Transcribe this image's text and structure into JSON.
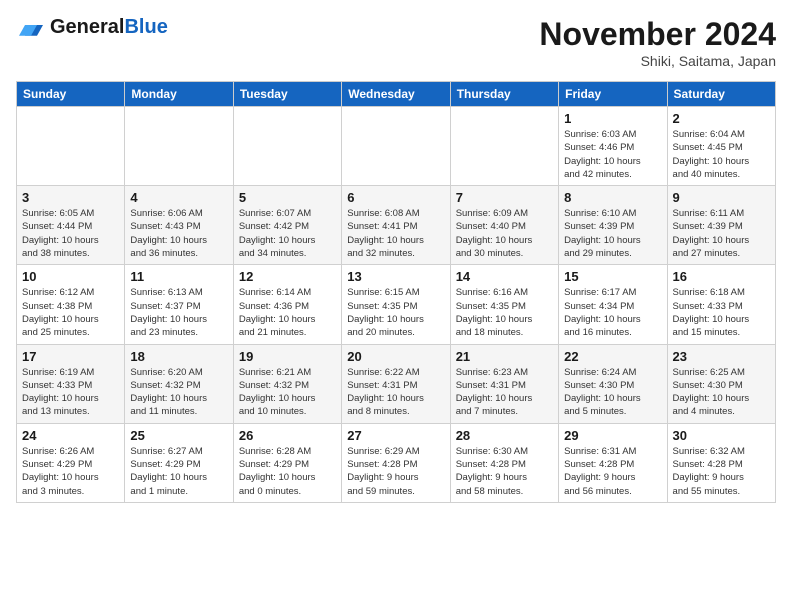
{
  "header": {
    "logo_line1": "General",
    "logo_line2": "Blue",
    "month": "November 2024",
    "location": "Shiki, Saitama, Japan"
  },
  "weekdays": [
    "Sunday",
    "Monday",
    "Tuesday",
    "Wednesday",
    "Thursday",
    "Friday",
    "Saturday"
  ],
  "weeks": [
    [
      {
        "day": "",
        "detail": ""
      },
      {
        "day": "",
        "detail": ""
      },
      {
        "day": "",
        "detail": ""
      },
      {
        "day": "",
        "detail": ""
      },
      {
        "day": "",
        "detail": ""
      },
      {
        "day": "1",
        "detail": "Sunrise: 6:03 AM\nSunset: 4:46 PM\nDaylight: 10 hours\nand 42 minutes."
      },
      {
        "day": "2",
        "detail": "Sunrise: 6:04 AM\nSunset: 4:45 PM\nDaylight: 10 hours\nand 40 minutes."
      }
    ],
    [
      {
        "day": "3",
        "detail": "Sunrise: 6:05 AM\nSunset: 4:44 PM\nDaylight: 10 hours\nand 38 minutes."
      },
      {
        "day": "4",
        "detail": "Sunrise: 6:06 AM\nSunset: 4:43 PM\nDaylight: 10 hours\nand 36 minutes."
      },
      {
        "day": "5",
        "detail": "Sunrise: 6:07 AM\nSunset: 4:42 PM\nDaylight: 10 hours\nand 34 minutes."
      },
      {
        "day": "6",
        "detail": "Sunrise: 6:08 AM\nSunset: 4:41 PM\nDaylight: 10 hours\nand 32 minutes."
      },
      {
        "day": "7",
        "detail": "Sunrise: 6:09 AM\nSunset: 4:40 PM\nDaylight: 10 hours\nand 30 minutes."
      },
      {
        "day": "8",
        "detail": "Sunrise: 6:10 AM\nSunset: 4:39 PM\nDaylight: 10 hours\nand 29 minutes."
      },
      {
        "day": "9",
        "detail": "Sunrise: 6:11 AM\nSunset: 4:39 PM\nDaylight: 10 hours\nand 27 minutes."
      }
    ],
    [
      {
        "day": "10",
        "detail": "Sunrise: 6:12 AM\nSunset: 4:38 PM\nDaylight: 10 hours\nand 25 minutes."
      },
      {
        "day": "11",
        "detail": "Sunrise: 6:13 AM\nSunset: 4:37 PM\nDaylight: 10 hours\nand 23 minutes."
      },
      {
        "day": "12",
        "detail": "Sunrise: 6:14 AM\nSunset: 4:36 PM\nDaylight: 10 hours\nand 21 minutes."
      },
      {
        "day": "13",
        "detail": "Sunrise: 6:15 AM\nSunset: 4:35 PM\nDaylight: 10 hours\nand 20 minutes."
      },
      {
        "day": "14",
        "detail": "Sunrise: 6:16 AM\nSunset: 4:35 PM\nDaylight: 10 hours\nand 18 minutes."
      },
      {
        "day": "15",
        "detail": "Sunrise: 6:17 AM\nSunset: 4:34 PM\nDaylight: 10 hours\nand 16 minutes."
      },
      {
        "day": "16",
        "detail": "Sunrise: 6:18 AM\nSunset: 4:33 PM\nDaylight: 10 hours\nand 15 minutes."
      }
    ],
    [
      {
        "day": "17",
        "detail": "Sunrise: 6:19 AM\nSunset: 4:33 PM\nDaylight: 10 hours\nand 13 minutes."
      },
      {
        "day": "18",
        "detail": "Sunrise: 6:20 AM\nSunset: 4:32 PM\nDaylight: 10 hours\nand 11 minutes."
      },
      {
        "day": "19",
        "detail": "Sunrise: 6:21 AM\nSunset: 4:32 PM\nDaylight: 10 hours\nand 10 minutes."
      },
      {
        "day": "20",
        "detail": "Sunrise: 6:22 AM\nSunset: 4:31 PM\nDaylight: 10 hours\nand 8 minutes."
      },
      {
        "day": "21",
        "detail": "Sunrise: 6:23 AM\nSunset: 4:31 PM\nDaylight: 10 hours\nand 7 minutes."
      },
      {
        "day": "22",
        "detail": "Sunrise: 6:24 AM\nSunset: 4:30 PM\nDaylight: 10 hours\nand 5 minutes."
      },
      {
        "day": "23",
        "detail": "Sunrise: 6:25 AM\nSunset: 4:30 PM\nDaylight: 10 hours\nand 4 minutes."
      }
    ],
    [
      {
        "day": "24",
        "detail": "Sunrise: 6:26 AM\nSunset: 4:29 PM\nDaylight: 10 hours\nand 3 minutes."
      },
      {
        "day": "25",
        "detail": "Sunrise: 6:27 AM\nSunset: 4:29 PM\nDaylight: 10 hours\nand 1 minute."
      },
      {
        "day": "26",
        "detail": "Sunrise: 6:28 AM\nSunset: 4:29 PM\nDaylight: 10 hours\nand 0 minutes."
      },
      {
        "day": "27",
        "detail": "Sunrise: 6:29 AM\nSunset: 4:28 PM\nDaylight: 9 hours\nand 59 minutes."
      },
      {
        "day": "28",
        "detail": "Sunrise: 6:30 AM\nSunset: 4:28 PM\nDaylight: 9 hours\nand 58 minutes."
      },
      {
        "day": "29",
        "detail": "Sunrise: 6:31 AM\nSunset: 4:28 PM\nDaylight: 9 hours\nand 56 minutes."
      },
      {
        "day": "30",
        "detail": "Sunrise: 6:32 AM\nSunset: 4:28 PM\nDaylight: 9 hours\nand 55 minutes."
      }
    ]
  ]
}
